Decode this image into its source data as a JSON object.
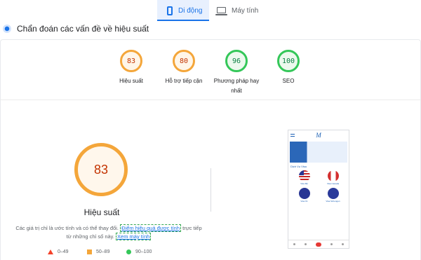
{
  "tabs": {
    "mobile": {
      "label": "Di động",
      "active": true
    },
    "desktop": {
      "label": "Máy tính",
      "active": false
    }
  },
  "section": {
    "title": "Chẩn đoán các vấn đề về hiệu suất"
  },
  "scores": [
    {
      "value": "83",
      "label": "Hiệu suất",
      "status": "orange"
    },
    {
      "value": "80",
      "label": "Hỗ trợ tiếp cận",
      "status": "orange"
    },
    {
      "value": "96",
      "label": "Phương pháp hay nhất",
      "status": "green"
    },
    {
      "value": "100",
      "label": "SEO",
      "status": "green"
    }
  ],
  "performance": {
    "score": "83",
    "label": "Hiệu suất",
    "note_pre": "Các giá trị chỉ là ước tính và có thể thay đổi.",
    "note_link1": "Điểm hiệu quả được tính",
    "note_mid": " trực tiếp từ những chỉ số này.",
    "note_link2": "Xem máy tính"
  },
  "legend": {
    "fail": "0–49",
    "average": "50–89",
    "pass": "90–100"
  },
  "screenshot": {
    "section_title": "Dịch Vụ Visa",
    "countries": [
      "Visa Mỹ",
      "Visa Canada",
      "Visa Úc",
      "Visa Schengen"
    ]
  },
  "colors": {
    "accent": "#1a73e8",
    "average": "#f4a63a",
    "pass": "#34c759",
    "fail": "#f4422a"
  }
}
